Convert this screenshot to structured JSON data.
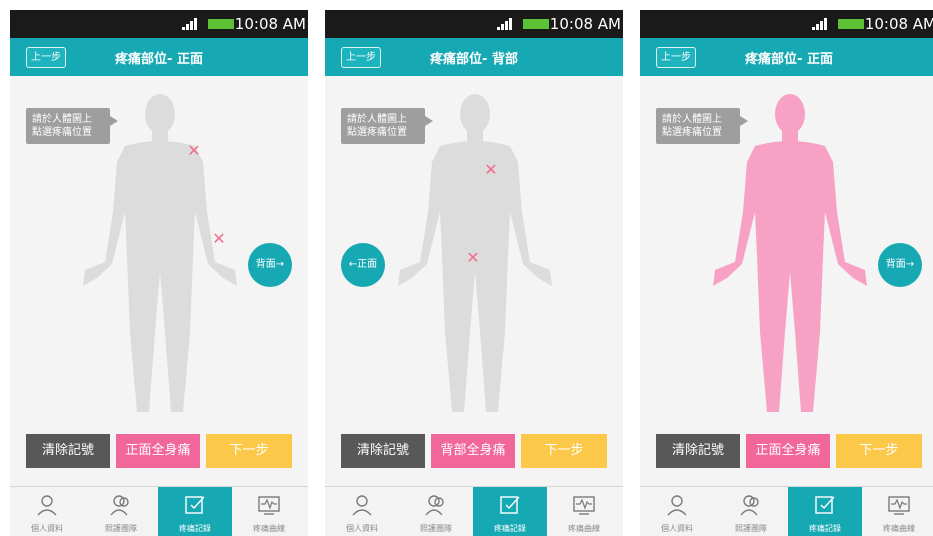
{
  "status": {
    "time": "10:08 AM"
  },
  "back_label": "上一步",
  "tooltip_lines": [
    "請於人體圖上",
    "點選疼痛位置"
  ],
  "actions": {
    "clear": "清除記號",
    "next": "下一步"
  },
  "tabs": [
    "個人資料",
    "照護團隊",
    "疼痛記錄",
    "疼痛曲線"
  ],
  "screens": [
    {
      "title": "疼痛部位- 正面",
      "full_body": "正面全身痛",
      "side_button": "背面→",
      "side": "right",
      "body_color": "#dcdcdc",
      "markers": [
        [
          183,
          148
        ],
        [
          218,
          236
        ]
      ]
    },
    {
      "title": "疼痛部位- 背部",
      "full_body": "背部全身痛",
      "side_button": "←正面",
      "side": "left",
      "body_color": "#dcdcdc",
      "markers": [
        [
          491,
          168
        ],
        [
          473,
          256
        ]
      ]
    },
    {
      "title": "疼痛部位- 正面",
      "full_body": "正面全身痛",
      "side_button": "背面→",
      "side": "right",
      "body_color": "#f7a1c4",
      "markers": []
    }
  ],
  "colors": {
    "teal": "#17a9b3",
    "pink": "#f2679a",
    "yellow": "#fcc84a",
    "dark": "#585858"
  }
}
